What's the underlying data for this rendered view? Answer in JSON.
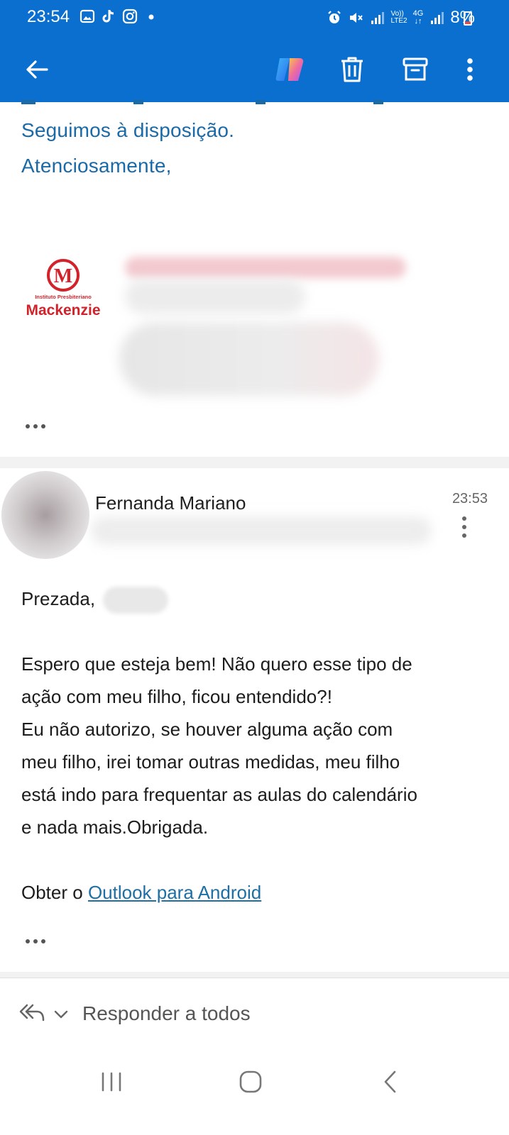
{
  "status_bar": {
    "time": "23:54",
    "battery": "8%",
    "network": "4G",
    "lte_label": "LTE2",
    "volte_label": "Vo))"
  },
  "app_bar": {
    "icons": [
      "back-arrow-icon",
      "copilot-icon",
      "trash-icon",
      "archive-icon",
      "more-vertical-icon"
    ],
    "accent_color": "#0a6fcf"
  },
  "previous_message": {
    "line1": "Seguimos à disposição.",
    "line2": "Atenciosamente,",
    "logo": {
      "subtitle": "Instituto Presbiteriano",
      "name": "Mackenzie",
      "letter": "M",
      "color": "#d2232a"
    }
  },
  "message": {
    "sender": "Fernanda Mariano",
    "time": "23:53",
    "greeting": "Prezada,",
    "paragraph1_line1": "Espero que esteja bem! Não quero esse tipo de",
    "paragraph1_line2": "ação com meu filho, ficou entendido?!",
    "paragraph2_line1": "Eu não autorizo, se houver alguma ação com",
    "paragraph2_line2": "meu filho, irei tomar outras medidas, meu filho",
    "paragraph2_line3": "está indo para frequentar as aulas do calendário",
    "paragraph2_line4": "e nada mais.Obrigada.",
    "signature_prefix": "Obter o ",
    "signature_link": "Outlook para Android"
  },
  "reply_bar": {
    "label": "Responder a todos"
  },
  "nav_bar": {
    "icons": [
      "recents-icon",
      "home-icon",
      "back-icon"
    ]
  }
}
